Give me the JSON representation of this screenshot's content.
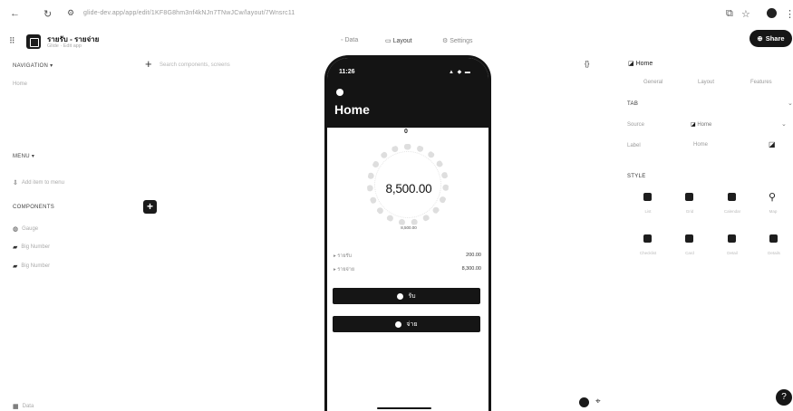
{
  "browser": {
    "back_icon": "back-arrow-icon",
    "reload_icon": "reload-icon",
    "url": "glide-dev.app/app/edit/1KF8G8hm3nf4kNJn7TNwJCw/layout/7Wnsrc11"
  },
  "app": {
    "title": "รายรับ - รายจ่าย",
    "subtitle": "Glide · Edit app",
    "tabs": [
      "Data",
      "Layout",
      "Settings"
    ],
    "share_label": "Share"
  },
  "sidebar": {
    "navigation_header": "NAVIGATION",
    "navigation_items": [
      "Home"
    ],
    "search_placeholder": "Search components, screens",
    "menu_header": "MENU",
    "menu_items": [
      "Add item to menu"
    ],
    "components_header": "COMPONENTS",
    "components_items": [
      "Gauge",
      "Big Number",
      "Big Number"
    ],
    "footer_label": "Data"
  },
  "phone": {
    "time": "11:26",
    "status": "▲ ◆ ▬",
    "screen_title": "Home",
    "gauge_top": "0",
    "gauge_value": "8,500.00",
    "gauge_sub": "8,500.00",
    "rows": [
      {
        "label": "รายรับ",
        "value": "200.00"
      },
      {
        "label": "รายจ่าย",
        "value": "8,300.00"
      }
    ],
    "buttons": [
      "รับ",
      "จ่าย"
    ]
  },
  "right_panel": {
    "component_name": "Home",
    "tabs": [
      "General",
      "Layout",
      "Features"
    ],
    "tab_header": "TAB",
    "fields": [
      {
        "label": "Source",
        "value": "Home"
      },
      {
        "label": "Label",
        "value": "Home"
      }
    ],
    "style_header": "STYLE",
    "style_options": [
      {
        "icon": "list-icon",
        "caption": "List"
      },
      {
        "icon": "grid-icon",
        "caption": "Grid"
      },
      {
        "icon": "calendar-icon",
        "caption": "Calendar"
      },
      {
        "icon": "map-pin-icon",
        "caption": "Map"
      },
      {
        "icon": "checklist-icon",
        "caption": "Checklist"
      },
      {
        "icon": "card-icon",
        "caption": "Card"
      },
      {
        "icon": "document-icon",
        "caption": "Detail"
      },
      {
        "icon": "chart-icon",
        "caption": "Details"
      }
    ]
  }
}
